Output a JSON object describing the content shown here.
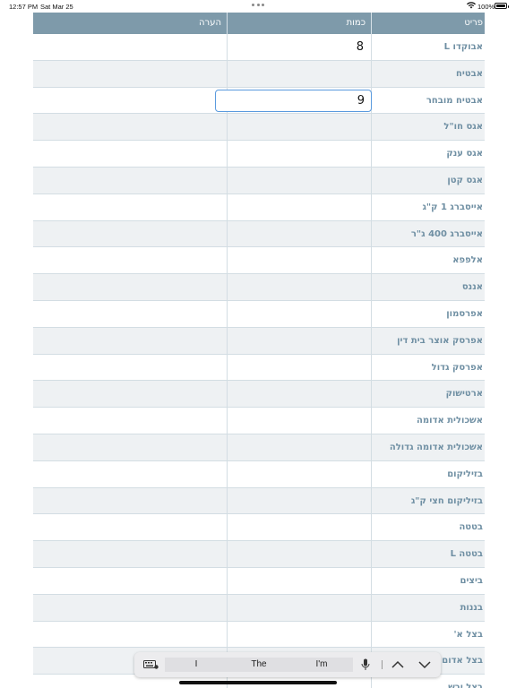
{
  "status_bar": {
    "time": "12:57 PM",
    "date": "Sat Mar 25",
    "battery": "100%"
  },
  "table": {
    "headers": {
      "item": "פריט",
      "qty": "כמות",
      "note": "הערה"
    },
    "rows": [
      {
        "item": "אבוקדו L",
        "qty": "8",
        "note": ""
      },
      {
        "item": "אבטיח",
        "qty": "",
        "note": ""
      },
      {
        "item": "אבטיח מובחר",
        "qty": "9",
        "note": "",
        "focused": true
      },
      {
        "item": "אגס חו\"ל",
        "qty": "",
        "note": ""
      },
      {
        "item": "אגס ענק",
        "qty": "",
        "note": ""
      },
      {
        "item": "אגס קטן",
        "qty": "",
        "note": ""
      },
      {
        "item": "אייסברג 1 ק\"ג",
        "qty": "",
        "note": ""
      },
      {
        "item": "אייסברג 400 ג\"ר",
        "qty": "",
        "note": ""
      },
      {
        "item": "אלפפא",
        "qty": "",
        "note": ""
      },
      {
        "item": "אננס",
        "qty": "",
        "note": ""
      },
      {
        "item": "אפרסמון",
        "qty": "",
        "note": ""
      },
      {
        "item": "אפרסק אוצר בית דין",
        "qty": "",
        "note": ""
      },
      {
        "item": "אפרסק גדול",
        "qty": "",
        "note": ""
      },
      {
        "item": "ארטישוק",
        "qty": "",
        "note": ""
      },
      {
        "item": "אשכולית אדומה",
        "qty": "",
        "note": ""
      },
      {
        "item": "אשכולית אדומה גדולה",
        "qty": "",
        "note": ""
      },
      {
        "item": "בזיליקום",
        "qty": "",
        "note": ""
      },
      {
        "item": "בזיליקום חצי ק\"ג",
        "qty": "",
        "note": ""
      },
      {
        "item": "בטטה",
        "qty": "",
        "note": ""
      },
      {
        "item": "בטטה L",
        "qty": "",
        "note": ""
      },
      {
        "item": "ביצים",
        "qty": "",
        "note": ""
      },
      {
        "item": "בננות",
        "qty": "",
        "note": ""
      },
      {
        "item": "בצל א'",
        "qty": "",
        "note": ""
      },
      {
        "item": "בצל אדום",
        "qty": "",
        "note": ""
      },
      {
        "item": "בצל יבש",
        "qty": "",
        "note": ""
      }
    ]
  },
  "keyboard_bar": {
    "suggestions": [
      "I",
      "The",
      "I'm"
    ],
    "icons": [
      "keyboard-icon",
      "microphone-icon",
      "chevron-up-icon",
      "chevron-down-icon"
    ]
  },
  "colors": {
    "header_bg": "#7e9aaa",
    "item_text": "#6f8fa3",
    "focus_border": "#5a9ade",
    "row_alt": "#eef1f3"
  }
}
